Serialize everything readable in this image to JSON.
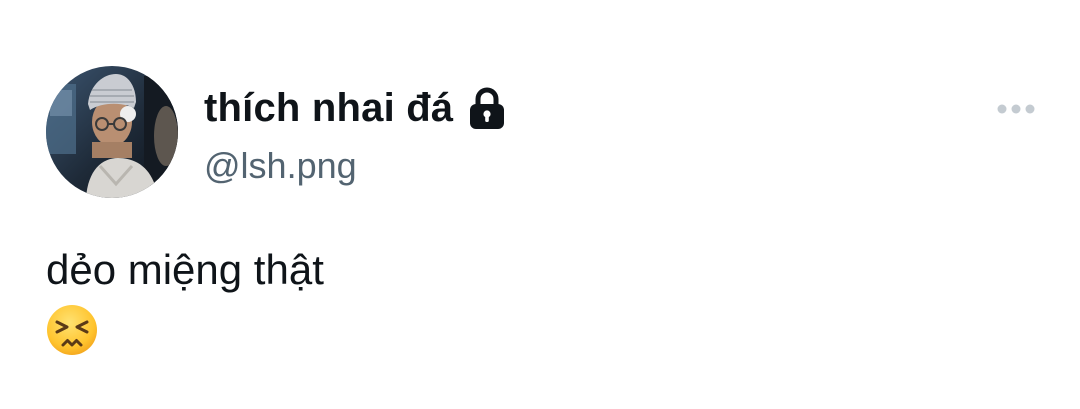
{
  "author": {
    "display_name": "thích nhai đá",
    "handle": "@lsh.png",
    "protected_icon": "lock-icon",
    "avatar_icon": "profile-photo"
  },
  "tweet": {
    "text": "dẻo miệng thật",
    "emoji": "persevering-face-emoji"
  },
  "actions": {
    "more_icon": "more-horizontal-icon"
  },
  "colors": {
    "text_primary": "#0f1419",
    "text_secondary": "#536471",
    "more_dots": "#c4cbd1",
    "background": "#ffffff"
  }
}
